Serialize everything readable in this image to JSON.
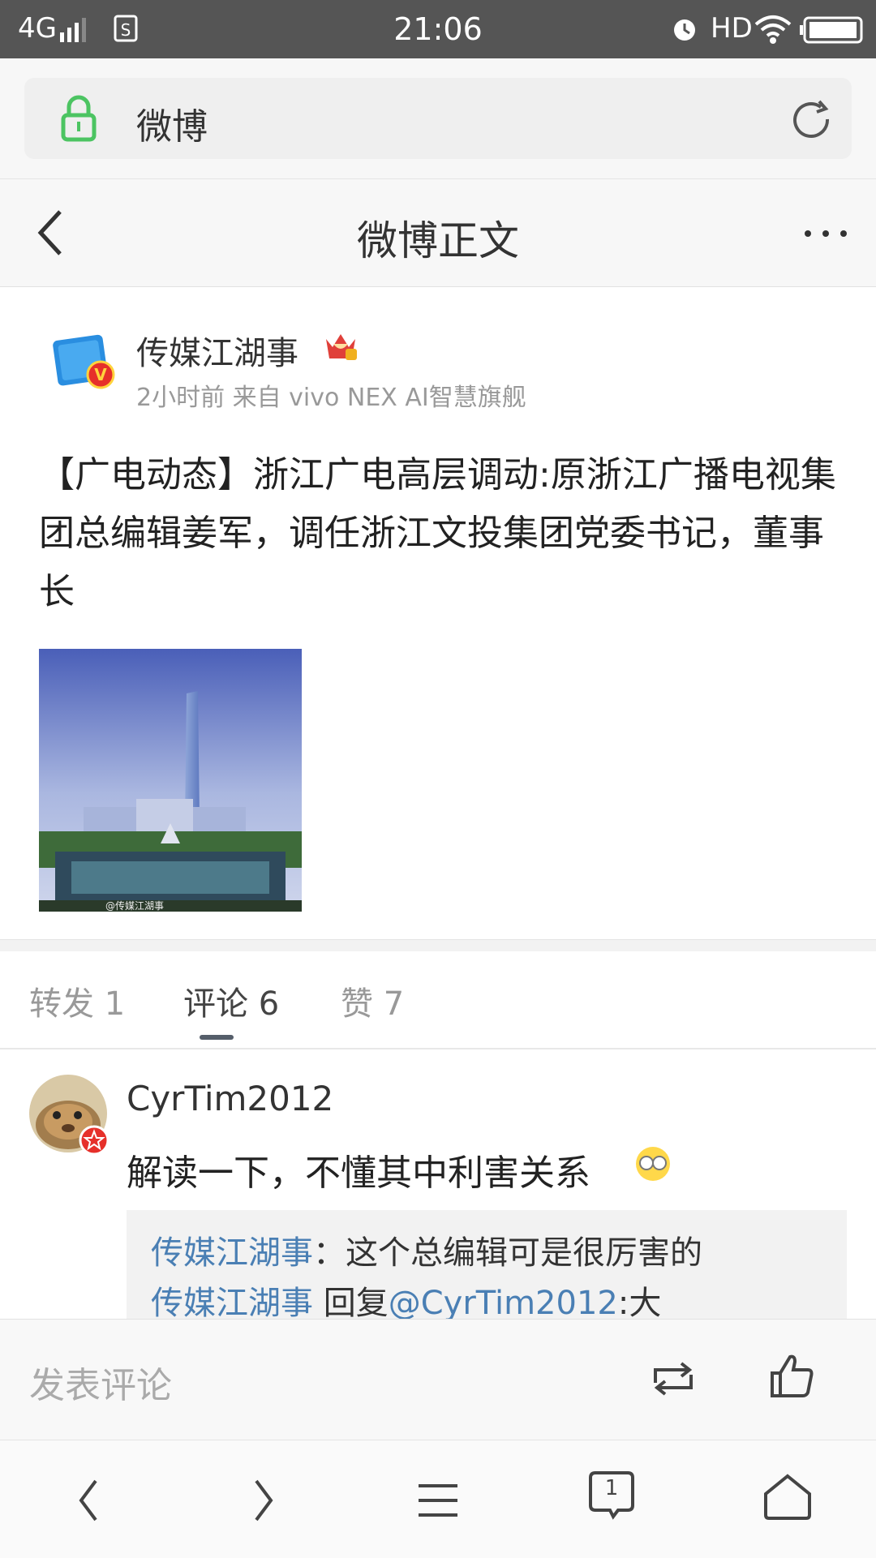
{
  "status_bar": {
    "network": "4G",
    "time": "21:06",
    "hd": "HD"
  },
  "url_bar": {
    "site_title": "微博"
  },
  "nav": {
    "title": "微博正文"
  },
  "post": {
    "author": "传媒江湖事",
    "meta": "2小时前  来自 vivo NEX AI智慧旗舰",
    "text": "【广电动态】浙江广电高层调动:原浙江广播电视集团总编辑姜军，调任浙江文投集团党委书记，董事长",
    "image_watermark": "@传媒江湖事"
  },
  "tabs": {
    "repost": "转发 1",
    "comment": "评论 6",
    "like": "赞 7",
    "selected": "comment"
  },
  "comment": {
    "user": "CyrTim2012",
    "text": "解读一下，不懂其中利害关系",
    "replies": [
      {
        "user": "传媒江湖事",
        "sep": "：",
        "text": "这个总编辑可是很厉害的"
      },
      {
        "user": "传媒江湖事",
        "pre": " 回复",
        "mention": "@CyrTim2012",
        "text": ":大"
      }
    ]
  },
  "comment_bar": {
    "placeholder": "发表评论"
  },
  "bottom_nav": {
    "tab_count": "1"
  },
  "colors": {
    "status_bar": "#555555",
    "link": "#4a7fb4",
    "lock_green": "#4cc462",
    "verified_badge": "#e6302a",
    "crown_red": "#e0403a",
    "crown_gold": "#f0b020"
  }
}
